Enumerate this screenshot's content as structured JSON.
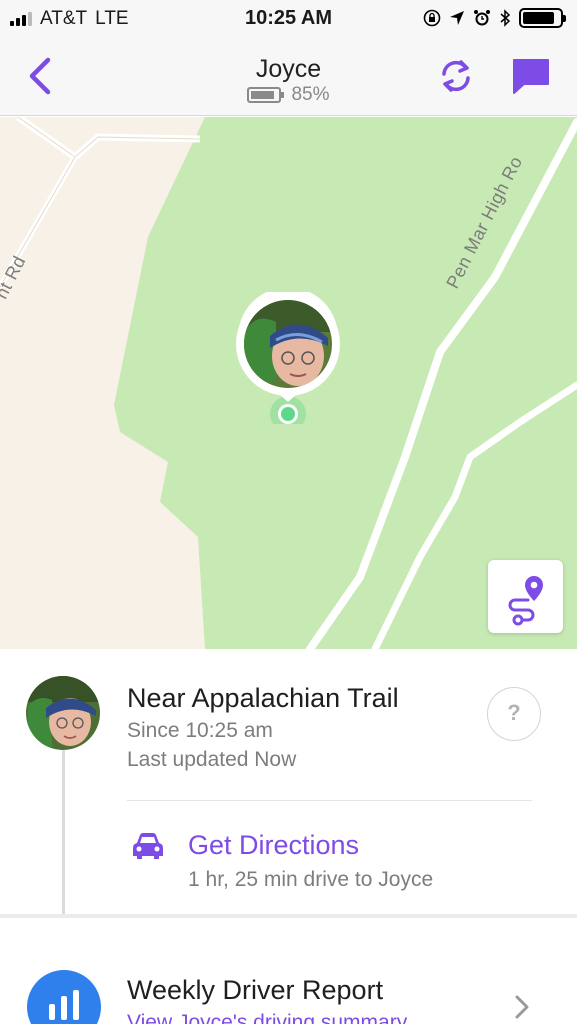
{
  "status_bar": {
    "carrier": "AT&T",
    "network": "LTE",
    "time": "10:25 AM"
  },
  "header": {
    "title": "Joyce",
    "battery_percent": "85%",
    "battery_level": 0.85
  },
  "map": {
    "road_labels": [
      "Pen Mar High Ro",
      "nt Rd"
    ],
    "colors": {
      "park": "#c7e9b3",
      "land": "#f7f1e8",
      "road": "#ffffff",
      "pin_dot": "#5bd88a"
    }
  },
  "place": {
    "name": "Near Appalachian Trail",
    "since": "Since 10:25 am",
    "last_updated": "Last updated Now",
    "help": "?"
  },
  "directions": {
    "label": "Get Directions",
    "info": "1 hr, 25 min drive to Joyce"
  },
  "report": {
    "title": "Weekly Driver Report",
    "link": "View Joyce's driving summary"
  },
  "accent_color": "#7d4ce6"
}
